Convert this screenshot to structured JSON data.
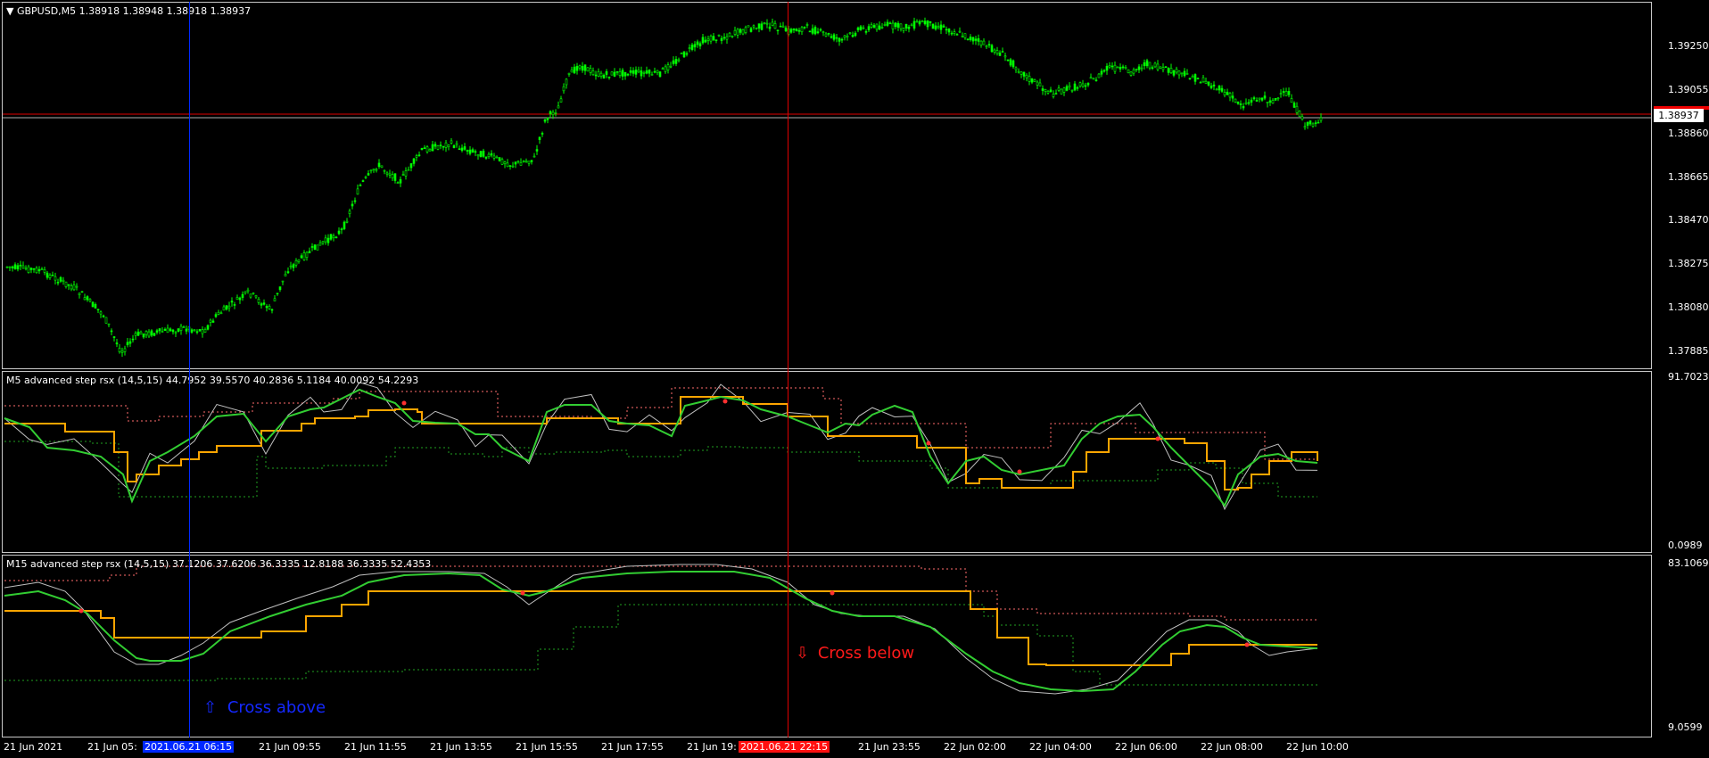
{
  "main_pane": {
    "symbol_menu": "▼",
    "title": "GBPUSD,M5  1.38918 1.38948 1.38918 1.38937",
    "current_price": "1.38937",
    "y_labels": [
      "1.39250",
      "1.39055",
      "1.38860",
      "1.38665",
      "1.38470",
      "1.38275",
      "1.38080",
      "1.37885"
    ]
  },
  "m5_pane": {
    "title": "M5 advanced step rsx (14,5,15) 44.7952 39.5570 40.2836 5.1184 40.0092 54.2293",
    "y_max": "91.7023",
    "y_min": "0.0989"
  },
  "m15_pane": {
    "title": "M15 advanced step rsx (14,5,15) 37.1206 37.6206 36.3335 12.8188 36.3335 52.4353",
    "y_max": "83.1069",
    "y_min": "9.0599"
  },
  "x_axis": {
    "labels": [
      "21 Jun 2021",
      "21 Jun 05:",
      "21 Jun 09:55",
      "21 Jun 11:55",
      "21 Jun 13:55",
      "21 Jun 15:55",
      "21 Jun 17:55",
      "21 Jun 19:",
      "21 Jun 23:55",
      "22 Jun 02:00",
      "22 Jun 04:00",
      "22 Jun 06:00",
      "22 Jun 08:00",
      "22 Jun 10:00"
    ],
    "blue_marker": "2021.06.21 06:15",
    "red_marker": "2021.06.21 22:15"
  },
  "annotations": {
    "cross_above": "Cross above",
    "cross_below": "Cross below"
  },
  "colors": {
    "candles": "#00ff00",
    "rsx_fast": "#32cd32",
    "rsx_step": "#ffa500",
    "rsx_raw": "#c0c0c0",
    "upper_band": "#ff6b6b",
    "lower_band": "#1fa01f",
    "blue_line": "#0028ff",
    "red_line": "#e00000"
  },
  "icons": {
    "arrow_up": "⇧",
    "arrow_down": "⇩"
  }
}
